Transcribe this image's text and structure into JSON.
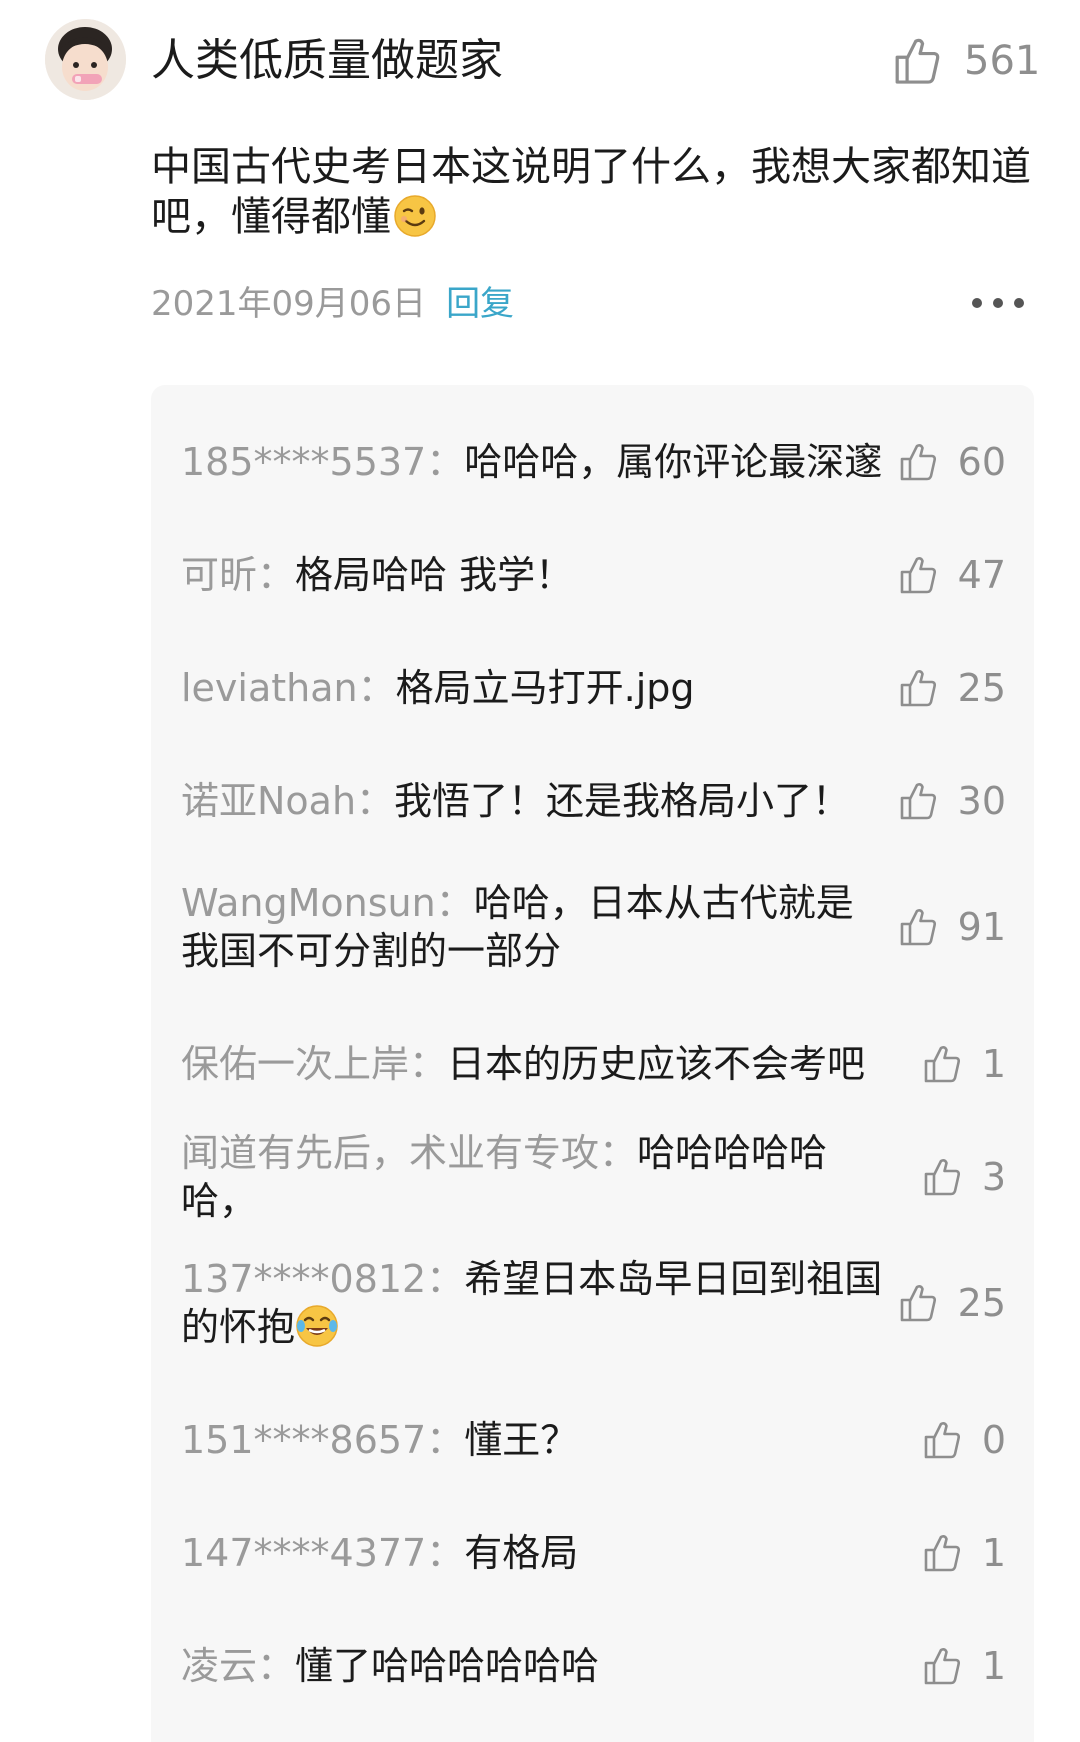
{
  "comment": {
    "author": "人类低质量做题家",
    "like_count": "561",
    "text": "中国古代史考日本这说明了什么，我想大家都知道吧，懂得都懂",
    "date": "2021年09月06日",
    "reply_label": "回复"
  },
  "replies": [
    {
      "name": "185****5537：",
      "text": "哈哈哈，属你评论最深邃",
      "likes": "60"
    },
    {
      "name": "可昕：",
      "text": "格局哈哈 我学！",
      "likes": "47"
    },
    {
      "name": "leviathan：",
      "text": "格局立马打开.jpg",
      "likes": "25"
    },
    {
      "name": "诺亚Noah：",
      "text": "我悟了！还是我格局小了！",
      "likes": "30"
    },
    {
      "name": "WangMonsun：",
      "text": "哈哈，日本从古代就是我国不可分割的一部分",
      "likes": "91"
    },
    {
      "name": "保佑一次上岸：",
      "text": "日本的历史应该不会考吧",
      "likes": "1"
    },
    {
      "name": "闻道有先后，术业有专攻：",
      "text": "哈哈哈哈哈哈，",
      "likes": "3"
    },
    {
      "name": "137****0812：",
      "text": "希望日本岛早日回到祖国的怀抱",
      "likes": "25"
    },
    {
      "name": "151****8657：",
      "text": "懂王？",
      "likes": "0"
    },
    {
      "name": "147****4377：",
      "text": "有格局",
      "likes": "1"
    },
    {
      "name": "凌云：",
      "text": "懂了哈哈哈哈哈哈",
      "likes": "1"
    }
  ],
  "icons": {
    "like": "thumbs-up-outline-icon",
    "more": "more-horizontal-icon",
    "wink_emoji": "wink-emoji",
    "laugh_emoji": "tears-of-joy-emoji"
  },
  "colors": {
    "reply_link": "#3aa6c9",
    "muted_text": "#9a9a9a",
    "panel_bg": "#f7f7f7"
  }
}
